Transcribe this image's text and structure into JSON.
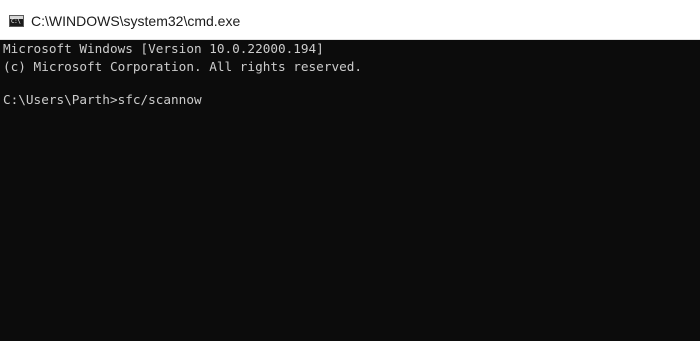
{
  "window": {
    "title": "C:\\WINDOWS\\system32\\cmd.exe",
    "app_icon": "cmd-icon",
    "app_icon_text": "C:\\"
  },
  "console": {
    "lines": [
      "Microsoft Windows [Version 10.0.22000.194]",
      "(c) Microsoft Corporation. All rights reserved.",
      "C:\\Users\\Parth>sfc/scannow"
    ]
  },
  "colors": {
    "console_background": "#0c0c0c",
    "console_text": "#cccccc",
    "titlebar_background": "#ffffff",
    "title_text": "#1b1b1b"
  }
}
